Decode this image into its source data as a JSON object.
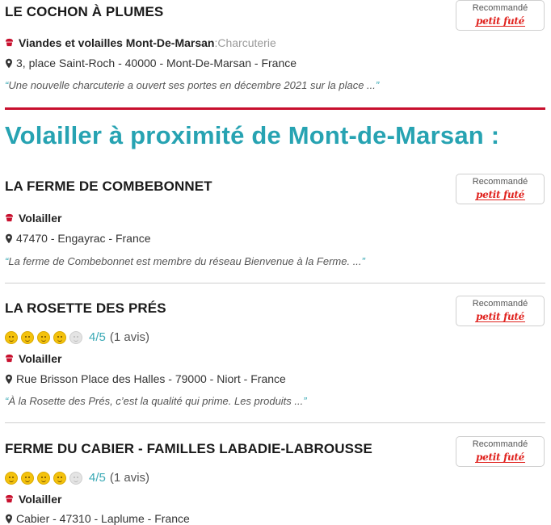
{
  "badge": {
    "label": "Recommandé",
    "logo_text": "petit futé"
  },
  "listings_before": [
    {
      "name": "LE COCHON À PLUMES",
      "category": "Viandes et volailles Mont-De-Marsan",
      "subcategory_sep": " : ",
      "subcategory": "Charcuterie",
      "address": "3, place Saint-Roch - 40000 - Mont-De-Marsan - France",
      "quote": "Une nouvelle charcuterie a ouvert ses portes en décembre 2021 sur la place ..."
    }
  ],
  "section_title": "Volailler à proximité de Mont-de-Marsan :",
  "listings": [
    {
      "name": "LA FERME DE COMBEBONNET",
      "category": "Volailler",
      "address": "47470 - Engayrac - France",
      "quote": "La ferme de Combebonnet est membre du réseau Bienvenue à la Ferme. ..."
    },
    {
      "name": "LA ROSETTE DES PRÉS",
      "rating": {
        "value": 4,
        "max": 5,
        "score_text": "4/5",
        "count_text": "(1 avis)"
      },
      "category": "Volailler",
      "address": "Rue Brisson Place des Halles - 79000 - Niort - France",
      "quote": "À la Rosette des Prés, c’est la qualité qui prime. Les produits ..."
    },
    {
      "name": "FERME DU CABIER - FAMILLES LABADIE-LABROUSSE",
      "rating": {
        "value": 4,
        "max": 5,
        "score_text": "4/5",
        "count_text": "(1 avis)"
      },
      "category": "Volailler",
      "address": "Cabier - 47310 - Laplume - France"
    }
  ],
  "colors": {
    "accent": "#27a3b2",
    "brand_red": "#c8102e",
    "logo_red": "#e0231f"
  },
  "icons": {
    "category": "cupcake-icon",
    "address": "map-pin-icon",
    "rating": "smiley-face-icon"
  }
}
